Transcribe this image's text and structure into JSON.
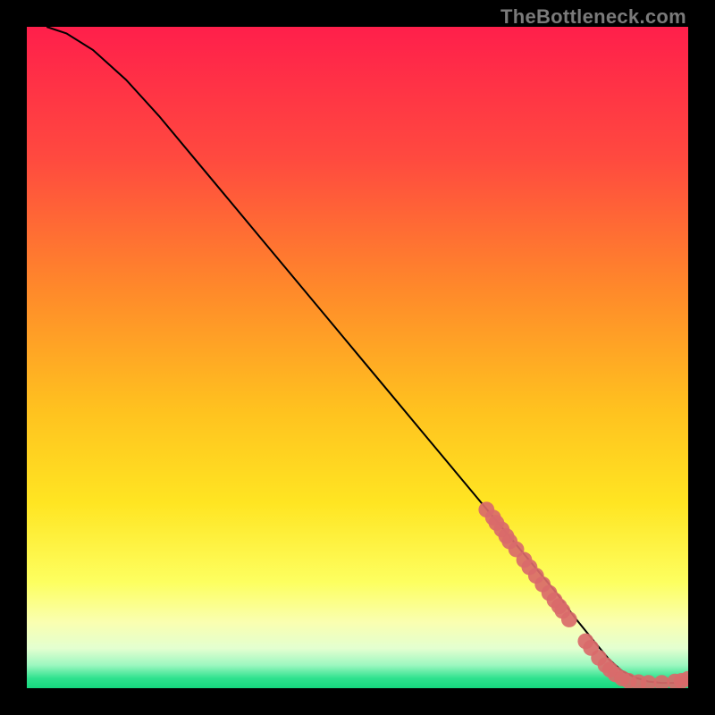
{
  "watermark": "TheBottleneck.com",
  "colors": {
    "line": "#000000",
    "marker_fill": "#d96a6a",
    "marker_stroke": "#d96a6a",
    "gradient_stops": [
      {
        "offset": 0.0,
        "color": "#ff1f4b"
      },
      {
        "offset": 0.2,
        "color": "#ff4a3f"
      },
      {
        "offset": 0.4,
        "color": "#ff8a2a"
      },
      {
        "offset": 0.58,
        "color": "#ffc21f"
      },
      {
        "offset": 0.72,
        "color": "#ffe522"
      },
      {
        "offset": 0.84,
        "color": "#fdff60"
      },
      {
        "offset": 0.9,
        "color": "#faffb0"
      },
      {
        "offset": 0.94,
        "color": "#e3ffd0"
      },
      {
        "offset": 0.965,
        "color": "#9df7c0"
      },
      {
        "offset": 0.985,
        "color": "#2fe28e"
      },
      {
        "offset": 1.0,
        "color": "#16d87e"
      }
    ]
  },
  "chart_data": {
    "type": "line",
    "title": "",
    "xlabel": "",
    "ylabel": "",
    "xlim": [
      0,
      100
    ],
    "ylim": [
      0,
      100
    ],
    "series": [
      {
        "name": "curve",
        "x": [
          3,
          6,
          10,
          15,
          20,
          25,
          30,
          35,
          40,
          45,
          50,
          55,
          60,
          65,
          70,
          75,
          80,
          83,
          86,
          88,
          90,
          92,
          94,
          96,
          98,
          100
        ],
        "y": [
          100,
          99,
          96.5,
          92,
          86.5,
          80.5,
          74.5,
          68.5,
          62.5,
          56.5,
          50.5,
          44.5,
          38.5,
          32.5,
          26.5,
          20.5,
          14.5,
          10.5,
          6.8,
          4.4,
          2.6,
          1.6,
          1.0,
          0.8,
          0.8,
          1.2
        ]
      }
    ],
    "markers": [
      {
        "x": 69.5,
        "y": 27.0
      },
      {
        "x": 70.5,
        "y": 25.8
      },
      {
        "x": 71.0,
        "y": 25.0
      },
      {
        "x": 71.8,
        "y": 24.0
      },
      {
        "x": 72.5,
        "y": 23.0
      },
      {
        "x": 73.0,
        "y": 22.2
      },
      {
        "x": 74.0,
        "y": 21.0
      },
      {
        "x": 75.2,
        "y": 19.4
      },
      {
        "x": 76.0,
        "y": 18.3
      },
      {
        "x": 77.0,
        "y": 17.0
      },
      {
        "x": 78.0,
        "y": 15.7
      },
      {
        "x": 79.0,
        "y": 14.4
      },
      {
        "x": 79.8,
        "y": 13.3
      },
      {
        "x": 80.5,
        "y": 12.4
      },
      {
        "x": 81.0,
        "y": 11.7
      },
      {
        "x": 82.0,
        "y": 10.4
      },
      {
        "x": 84.5,
        "y": 7.1
      },
      {
        "x": 85.3,
        "y": 6.1
      },
      {
        "x": 86.5,
        "y": 4.6
      },
      {
        "x": 87.5,
        "y": 3.5
      },
      {
        "x": 88.2,
        "y": 2.8
      },
      {
        "x": 89.0,
        "y": 2.1
      },
      {
        "x": 90.0,
        "y": 1.5
      },
      {
        "x": 91.0,
        "y": 1.1
      },
      {
        "x": 92.5,
        "y": 0.9
      },
      {
        "x": 94.0,
        "y": 0.8
      },
      {
        "x": 96.0,
        "y": 0.8
      },
      {
        "x": 98.0,
        "y": 1.0
      },
      {
        "x": 99.0,
        "y": 1.1
      },
      {
        "x": 100.0,
        "y": 1.4
      }
    ],
    "marker_radius_frac": 0.012
  }
}
